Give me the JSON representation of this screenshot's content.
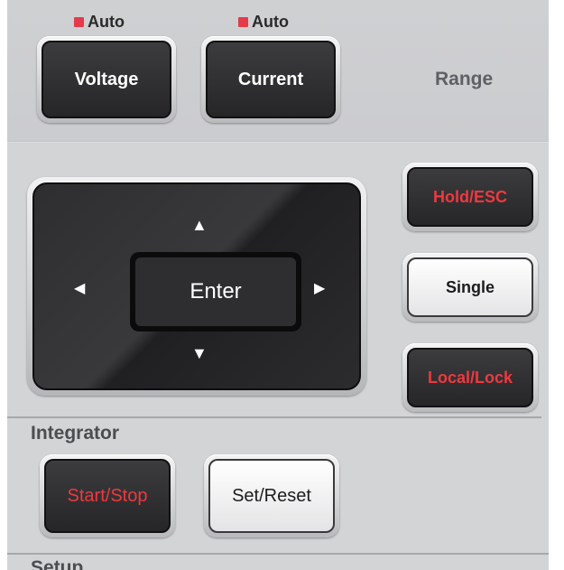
{
  "range": {
    "voltage_auto": "Auto",
    "current_auto": "Auto",
    "voltage_label": "Voltage",
    "current_label": "Current",
    "section_label": "Range"
  },
  "navigation": {
    "enter_label": "Enter",
    "up_icon": "▲",
    "down_icon": "▼",
    "left_icon": "◀",
    "right_icon": "▶"
  },
  "side_buttons": {
    "hold_esc_label": "Hold/ESC",
    "single_label": "Single",
    "local_lock_label": "Local/Lock"
  },
  "integrator": {
    "section_label": "Integrator",
    "start_stop_label": "Start/Stop",
    "set_reset_label": "Set/Reset"
  },
  "setup": {
    "section_label": "Setup"
  },
  "colors": {
    "panel": "#d3d4d6",
    "led": "#e43a4a",
    "accent_red_text": "#f0383f",
    "dark_button": "#2e2e30",
    "light_button": "#f2f2f3"
  }
}
